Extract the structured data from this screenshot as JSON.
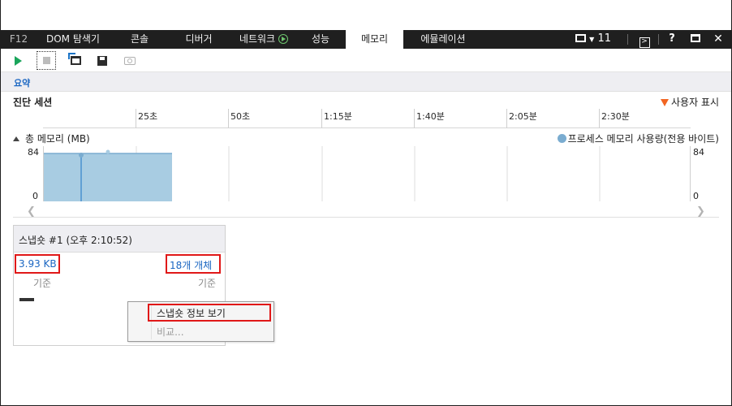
{
  "tabs": {
    "f12": "F12",
    "items": [
      "DOM 탐색기",
      "콘솔",
      "디버거",
      "네트워크",
      "성능",
      "메모리",
      "에뮬레이션"
    ],
    "active": "메모리"
  },
  "window_controls": {
    "target_count": "11",
    "help": "?"
  },
  "toolbar": {
    "buttons": [
      "start-icon",
      "stop-icon",
      "import-icon",
      "save-icon",
      "snapshot-icon"
    ]
  },
  "summary": {
    "link": "요약"
  },
  "session": {
    "title": "진단 세션",
    "user_marks": "사용자 표시",
    "ruler_labels": [
      "25초",
      "50초",
      "1:15분",
      "1:40분",
      "2:05분",
      "2:30분"
    ]
  },
  "memory": {
    "header": "총 메모리 (MB)",
    "legend": "프로세스 메모리 사용량(전용 바이트)",
    "y_max_left": "84",
    "y_min_left": "0",
    "y_max_right": "84",
    "y_min_right": "0",
    "fill_color": "#a8cce2",
    "line_color": "#7aacd0",
    "marker_color": "#1a73c6",
    "fill_level": 0.87
  },
  "snapshot": {
    "title": "스냅숏 #1 (오후 2:10:52)",
    "size": "3.93 KB",
    "size_sub": "기준",
    "objects": "18개 개체",
    "objects_sub": "기준"
  },
  "context_menu": {
    "items": [
      "스냅숏 정보 보기",
      "비교..."
    ]
  }
}
